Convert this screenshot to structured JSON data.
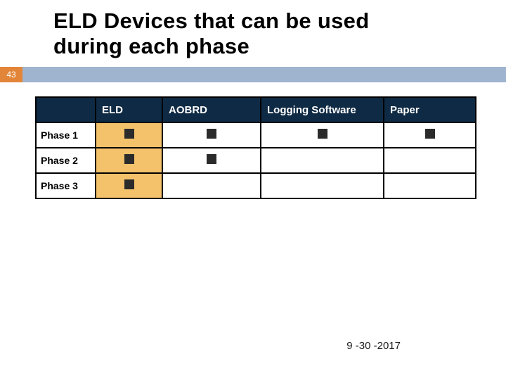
{
  "title_line1": "ELD Devices that can be used",
  "title_line2": "during each phase",
  "slide_number": "43",
  "columns": {
    "eld": "ELD",
    "aobrd": "AOBRD",
    "logging": "Logging Software",
    "paper": "Paper"
  },
  "rows": {
    "phase1": "Phase 1",
    "phase2": "Phase 2",
    "phase3": "Phase 3"
  },
  "footer_date": "9 -30 -2017",
  "chart_data": {
    "type": "table",
    "title": "ELD Devices that can be used during each phase",
    "columns": [
      "ELD",
      "AOBRD",
      "Logging Software",
      "Paper"
    ],
    "rows": [
      "Phase 1",
      "Phase 2",
      "Phase 3"
    ],
    "matrix": [
      [
        true,
        true,
        true,
        true
      ],
      [
        true,
        true,
        false,
        false
      ],
      [
        true,
        false,
        false,
        false
      ]
    ],
    "highlight_column": "ELD"
  }
}
